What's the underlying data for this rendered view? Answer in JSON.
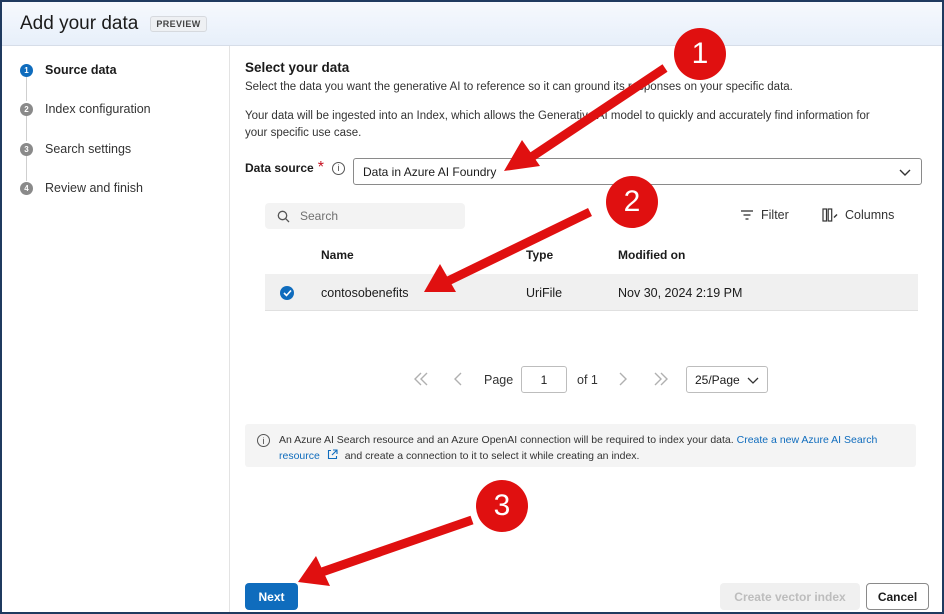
{
  "dialog": {
    "title": "Add your data",
    "badge": "PREVIEW"
  },
  "steps": [
    {
      "num": "1",
      "label": "Source data",
      "active": true
    },
    {
      "num": "2",
      "label": "Index configuration"
    },
    {
      "num": "3",
      "label": "Search settings"
    },
    {
      "num": "4",
      "label": "Review and finish"
    }
  ],
  "section": {
    "title": "Select your data",
    "desc1": "Select the data you want the generative AI to reference so it can ground its responses on your specific data.",
    "desc2": "Your data will be ingested into an Index, which allows the Generative AI model to quickly and accurately find information for your specific use case."
  },
  "data_source": {
    "label": "Data source",
    "required": "*",
    "info_icon": "info",
    "value": "Data in Azure AI Foundry"
  },
  "toolbar": {
    "search_placeholder": "Search",
    "filter_label": "Filter",
    "columns_label": "Columns"
  },
  "table": {
    "headers": [
      "Name",
      "Type",
      "Modified on"
    ],
    "rows": [
      {
        "name": "contosobenefits",
        "type": "UriFile",
        "modified": "Nov 30, 2024 2:19 PM",
        "selected": true
      }
    ]
  },
  "pagination": {
    "page_label": "Page",
    "page": "1",
    "of_label": "of 1",
    "page_size": "25/Page"
  },
  "notice": {
    "text": "An Azure AI Search resource and an Azure OpenAI connection will be required to index your data.",
    "link": "Create a new Azure AI Search resource",
    "text2": "and create a connection to it to select it while creating an index."
  },
  "footer": {
    "next": "Next",
    "create": "Create vector index",
    "cancel": "Cancel"
  },
  "callouts": [
    "1",
    "2",
    "3"
  ],
  "colors": {
    "accent": "#0f6cbd",
    "callout": "#e01010"
  }
}
